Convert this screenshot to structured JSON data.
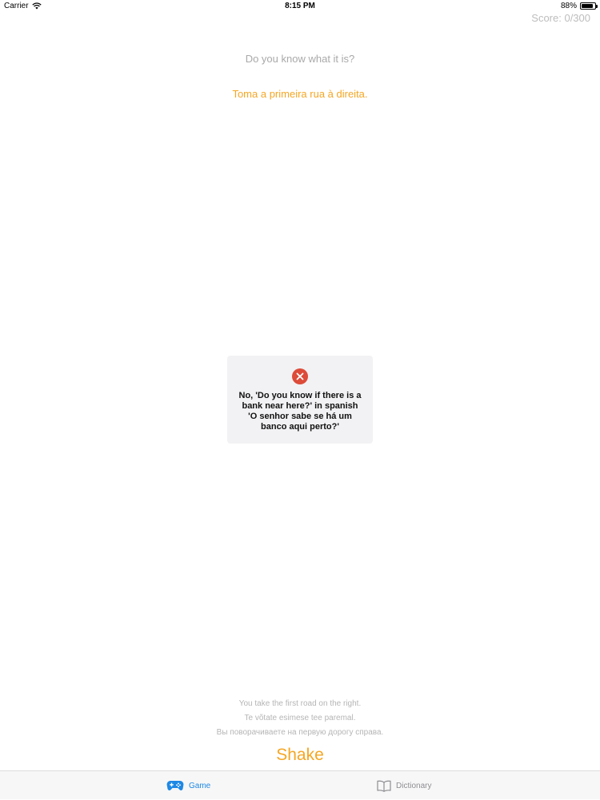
{
  "status_bar": {
    "carrier": "Carrier",
    "time": "8:15 PM",
    "battery_percent": "88%",
    "battery_level": 0.88
  },
  "score": "Score: 0/300",
  "question": "Do you know what it is?",
  "phrase": "Toma a primeira rua à direita.",
  "hud": {
    "icon": "error-x-icon",
    "message": "No, 'Do you know if there is a bank near here?' in spanish 'O senhor sabe se há um banco aqui perto?'"
  },
  "translations": [
    "You take the first road on the right.",
    "Te võtate esimese tee paremal.",
    "Вы поворачиваете на первую дорогу справа."
  ],
  "shake_label": "Shake",
  "tabs": [
    {
      "label": "Game",
      "icon": "gamepad-icon",
      "selected": true
    },
    {
      "label": "Dictionary",
      "icon": "book-icon",
      "selected": false
    }
  ],
  "colors": {
    "accent": "#f5a623",
    "tab_active": "#1e88e5",
    "tab_inactive": "#8e8e93",
    "error": "#dd4b39"
  }
}
